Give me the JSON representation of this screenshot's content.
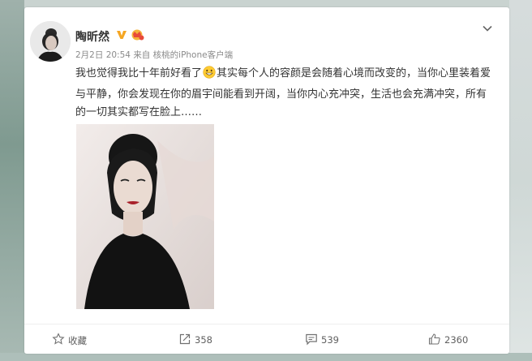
{
  "post": {
    "author": "陶昕然",
    "timestamp": "2月2日 20:54",
    "source": "来自 核桃的iPhone客户端",
    "text_part1": "我也觉得我比十年前好看了",
    "text_part2": "其实每个人的容颜是会随着心境而改变的，当你心里装着爱与平静，你会发现在你的眉宇间能看到开阔，当你内心充冲突，生活也会充满冲突，所有的一切其实都写在脸上……",
    "emoji_icon": "grin-emoji-icon",
    "badges": [
      "verified-v-icon",
      "vip-icon"
    ]
  },
  "actions": {
    "favorite_label": "收藏",
    "repost_count": "358",
    "comment_count": "539",
    "like_count": "2360"
  },
  "colors": {
    "verified_orange": "#f5a623",
    "vip_red": "#e84a3a",
    "text": "#333333",
    "meta": "#8a8a8a"
  }
}
